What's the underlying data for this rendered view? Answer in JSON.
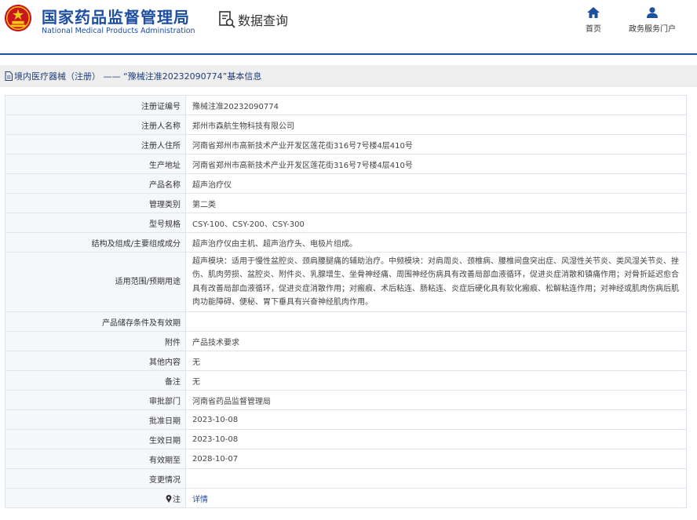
{
  "header": {
    "site_title_cn": "国家药品监督管理局",
    "site_title_en": "National Medical Products Administration",
    "query_label": "数据查询",
    "nav": [
      {
        "label": "首页",
        "icon": "home-icon"
      },
      {
        "label": "政务服务门户",
        "icon": "user-icon"
      }
    ]
  },
  "breadcrumb": {
    "text": "境内医疗器械（注册） —— “豫械注准20232090774”基本信息"
  },
  "rows": [
    {
      "label": "注册证编号",
      "value": "豫械注准20232090774"
    },
    {
      "label": "注册人名称",
      "value": "郑州市森航生物科技有限公司"
    },
    {
      "label": "注册人住所",
      "value": "河南省郑州市高新技术产业开发区莲花街316号7号楼4层410号"
    },
    {
      "label": "生产地址",
      "value": "河南省郑州市高新技术产业开发区莲花街316号7号楼4层410号"
    },
    {
      "label": "产品名称",
      "value": "超声治疗仪"
    },
    {
      "label": "管理类别",
      "value": "第二类"
    },
    {
      "label": "型号规格",
      "value": "CSY-100、CSY-200、CSY-300"
    },
    {
      "label": "结构及组成/主要组成成分",
      "value": "超声治疗仪由主机、超声治疗头、电极片组成。"
    },
    {
      "label": "适用范围/预期用途",
      "value": "超声模块：适用于慢性盆腔炎、颈肩腰腿痛的辅助治疗。中频模块：对肩周炎、颈椎病、腰椎间盘突出症、风湿性关节炎、类风湿关节炎、挫伤、肌肉劳损、盆腔炎、附件炎、乳腺增生、坐骨神经痛、周围神经伤病具有改善局部血液循环，促进炎症消散和镇痛作用；对骨折延迟愈合具有改善局部血液循环，促进炎症消散作用；对瘢痕、术后粘连、肠粘连、炎症后硬化具有软化瘢痕、松解粘连作用；对神经或肌肉伤病后肌肉功能障碍、便秘、胃下垂具有兴奋神经肌肉作用。"
    },
    {
      "label": "产品储存条件及有效期",
      "value": ""
    },
    {
      "label": "附件",
      "value": "产品技术要求"
    },
    {
      "label": "其他内容",
      "value": "无"
    },
    {
      "label": "备注",
      "value": "无"
    },
    {
      "label": "审批部门",
      "value": "河南省药品监督管理局"
    },
    {
      "label": "批准日期",
      "value": "2023-10-08"
    },
    {
      "label": "生效日期",
      "value": "2023-10-08"
    },
    {
      "label": "有效期至",
      "value": "2028-10-07"
    },
    {
      "label": "变更情况",
      "value": ""
    }
  ],
  "note_row": {
    "label": "注",
    "link": "详情"
  },
  "colors": {
    "brand_blue": "#1d4ea1",
    "label_bg": "#f5f7fa",
    "border": "#dfe4ec"
  }
}
